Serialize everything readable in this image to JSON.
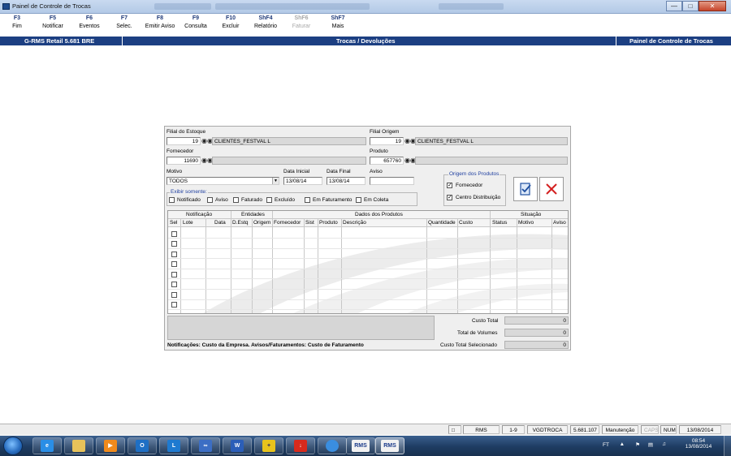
{
  "window": {
    "title": "Painel de Controle de Trocas"
  },
  "toolbar": {
    "keys": [
      {
        "key": "F3",
        "label": "Fim",
        "enabled": true
      },
      {
        "key": "F5",
        "label": "Notificar",
        "enabled": true
      },
      {
        "key": "F6",
        "label": "Eventos",
        "enabled": true
      },
      {
        "key": "F7",
        "label": "Selec.",
        "enabled": true
      },
      {
        "key": "F8",
        "label": "Emitir Aviso",
        "enabled": true
      },
      {
        "key": "F9",
        "label": "Consulta",
        "enabled": true
      },
      {
        "key": "F10",
        "label": "Excluir",
        "enabled": true
      },
      {
        "key": "ShF4",
        "label": "Relatório",
        "enabled": true
      },
      {
        "key": "ShF6",
        "label": "Faturar",
        "enabled": false
      },
      {
        "key": "ShF7",
        "label": "Mais",
        "enabled": true
      }
    ]
  },
  "header": {
    "left": "G-RMS Retail 5.681 BRE",
    "center": "Trocas / Devoluções",
    "right": "Painel de Controle de Trocas",
    "color": "#1c3f82"
  },
  "form": {
    "filial_estoque": {
      "label": "Filial do Estoque",
      "code": "19",
      "name": "CLIENTES_FESTVAL L"
    },
    "filial_origem": {
      "label": "Filial Origem",
      "code": "19",
      "name": "CLIENTES_FESTVAL L"
    },
    "fornecedor": {
      "label": "Fornecedor",
      "code": "11690",
      "name": ""
    },
    "produto": {
      "label": "Produto",
      "code": "657760",
      "name": ""
    },
    "motivo": {
      "label": "Motivo",
      "value": "TODOS"
    },
    "data_inicial": {
      "label": "Data Inicial",
      "value": "13/08/14"
    },
    "data_final": {
      "label": "Data Final",
      "value": "13/08/14"
    },
    "aviso": {
      "label": "Aviso",
      "value": ""
    },
    "exibir_somente": {
      "label": "Exibir somente:",
      "options": [
        {
          "label": "Notificado",
          "checked": false
        },
        {
          "label": "Aviso",
          "checked": false
        },
        {
          "label": "Faturado",
          "checked": false
        },
        {
          "label": "Excluído",
          "checked": false
        },
        {
          "label": "Em Faturamento",
          "checked": false
        },
        {
          "label": "Em Coleta",
          "checked": false
        }
      ]
    },
    "origem_produtos": {
      "label": "Origem dos Produtos",
      "options": [
        {
          "label": "Fornecedor",
          "checked": true
        },
        {
          "label": "Centro Distribuição",
          "checked": true
        }
      ]
    }
  },
  "grid": {
    "groups": [
      "Notificação",
      "Entidades",
      "Dados dos Produtos",
      "Situação"
    ],
    "columns": [
      "Sel",
      "Lote",
      "Data",
      "D.Estq",
      "Origem",
      "Fornecedor",
      "Sist",
      "Produto",
      "Descrição",
      "Quantidade",
      "Custo",
      "Status",
      "Motivo",
      "Aviso"
    ],
    "rows": 8
  },
  "totals": {
    "custo_total": {
      "label": "Custo Total",
      "value": "0"
    },
    "total_volumes": {
      "label": "Total de Volumes",
      "value": "0"
    },
    "custo_total_selecionado": {
      "label": "Custo Total Selecionado",
      "value": "0"
    }
  },
  "footnote": "Notificações: Custo da Empresa. Avisos/Faturamentos: Custo de Faturamento",
  "statusbar": {
    "app": "RMS",
    "range": "1-9",
    "program": "VGDTROCA",
    "version": "5.681.107",
    "mode": "Manutenção",
    "caps": "CAPS",
    "num": "NUM",
    "date": "13/08/2014"
  },
  "taskbar": {
    "apps": [
      "ie-icon",
      "explorer-icon",
      "media-icon",
      "outlook-icon",
      "lync-icon",
      "link-icon",
      "word-icon",
      "app-icon",
      "pdf-icon",
      "chrome-icon",
      "rms-icon",
      "rms-icon"
    ],
    "rms_label": "RMS",
    "lang": "FT",
    "time": "08:54",
    "date": "13/08/2014"
  }
}
